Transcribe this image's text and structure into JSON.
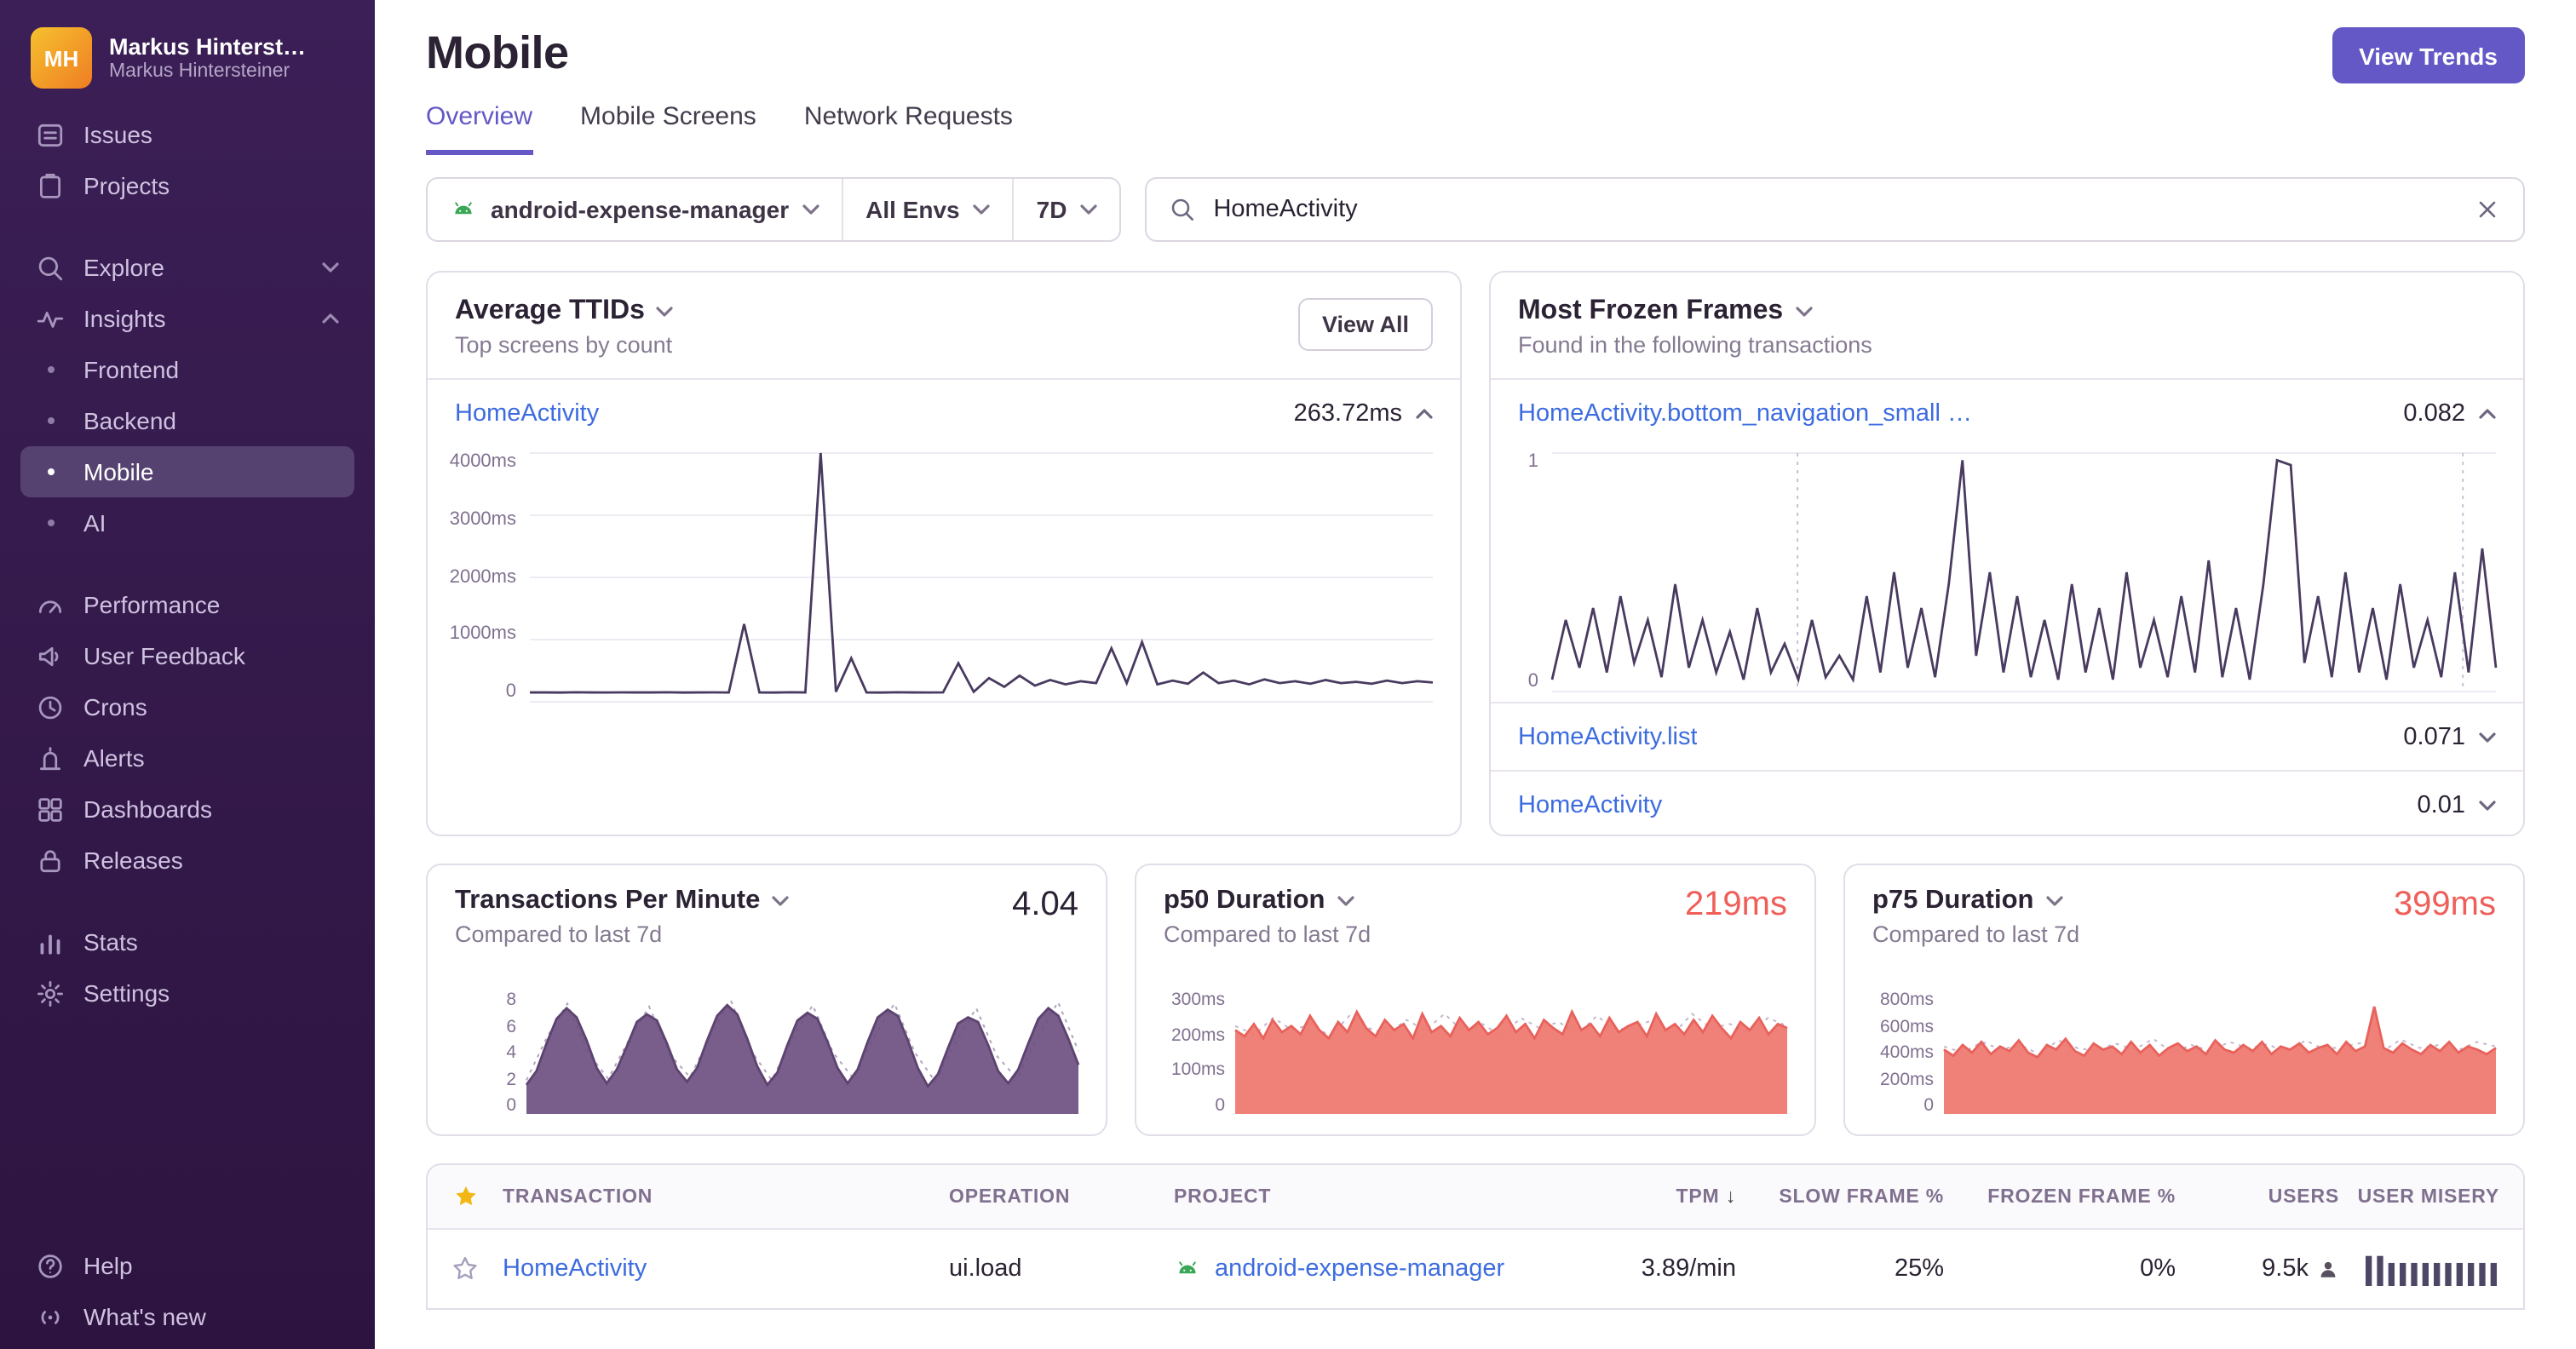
{
  "colors": {
    "accent": "#6358c6",
    "link": "#3d6ce0",
    "danger": "#ef5e58",
    "android_green": "#3aa757",
    "star_gold": "#f2b712"
  },
  "sidebar": {
    "account": {
      "initials": "MH",
      "name": "Markus Hinterst…",
      "subtitle": "Markus Hintersteiner"
    },
    "primary": [
      "Issues",
      "Projects"
    ],
    "explore_label": "Explore",
    "insights_label": "Insights",
    "insights_children": [
      "Frontend",
      "Backend",
      "Mobile",
      "AI"
    ],
    "secondary": [
      "Performance",
      "User Feedback",
      "Crons",
      "Alerts",
      "Dashboards",
      "Releases"
    ],
    "tertiary": [
      "Stats",
      "Settings"
    ],
    "footer": [
      "Help",
      "What's new"
    ]
  },
  "header": {
    "title": "Mobile",
    "view_trends_label": "View Trends"
  },
  "tabs": [
    "Overview",
    "Mobile Screens",
    "Network Requests"
  ],
  "filters": {
    "project": "android-expense-manager",
    "env": "All Envs",
    "period": "7D",
    "search_value": "HomeActivity"
  },
  "cards": {
    "ttid": {
      "title": "Average TTIDs",
      "subtitle": "Top screens by count",
      "view_all_label": "View All",
      "row_label": "HomeActivity",
      "row_value": "263.72ms",
      "y_labels": [
        "4000ms",
        "3000ms",
        "2000ms",
        "1000ms",
        "0"
      ]
    },
    "frozen": {
      "title": "Most Frozen Frames",
      "subtitle": "Found in the following transactions",
      "rows": [
        {
          "label": "HomeActivity.bottom_navigation_small …",
          "value": "0.082"
        },
        {
          "label": "HomeActivity.list",
          "value": "0.071"
        },
        {
          "label": "HomeActivity",
          "value": "0.01"
        }
      ],
      "y_labels": [
        "1",
        "0"
      ]
    },
    "tpm": {
      "title": "Transactions Per Minute",
      "value": "4.04",
      "subtitle": "Compared to last 7d",
      "y_labels": [
        "8",
        "6",
        "4",
        "2",
        "0"
      ]
    },
    "p50": {
      "title": "p50 Duration",
      "value": "219ms",
      "subtitle": "Compared to last 7d",
      "y_labels": [
        "300ms",
        "200ms",
        "100ms",
        "0"
      ]
    },
    "p75": {
      "title": "p75 Duration",
      "value": "399ms",
      "subtitle": "Compared to last 7d",
      "y_labels": [
        "800ms",
        "600ms",
        "400ms",
        "200ms",
        "0"
      ]
    }
  },
  "charts": {
    "ttid": {
      "type": "line",
      "color": "#493a60",
      "max": 4000,
      "grid": [
        0,
        25,
        50,
        75,
        100
      ],
      "values": [
        150,
        150,
        148,
        152,
        150,
        149,
        151,
        150,
        150,
        152,
        148,
        150,
        151,
        149,
        1250,
        150,
        148,
        152,
        150,
        4000,
        160,
        700,
        150,
        148,
        152,
        150,
        149,
        151,
        620,
        160,
        380,
        240,
        420,
        260,
        350,
        280,
        330,
        300,
        860,
        300,
        960,
        280,
        340,
        290,
        470,
        300,
        340,
        280,
        360,
        300,
        330,
        290,
        350,
        300,
        320,
        290,
        340,
        300,
        330,
        310
      ]
    },
    "frozen": {
      "type": "line",
      "color": "#493a60",
      "max": 1,
      "grid": [
        0,
        100
      ],
      "markers_pct": [
        26,
        96.5
      ],
      "values": [
        0.05,
        0.3,
        0.1,
        0.35,
        0.08,
        0.4,
        0.12,
        0.3,
        0.06,
        0.45,
        0.1,
        0.3,
        0.08,
        0.25,
        0.05,
        0.35,
        0.08,
        0.2,
        0.05,
        0.3,
        0.06,
        0.15,
        0.05,
        0.4,
        0.08,
        0.5,
        0.1,
        0.35,
        0.06,
        0.45,
        0.97,
        0.15,
        0.5,
        0.08,
        0.4,
        0.06,
        0.3,
        0.05,
        0.45,
        0.08,
        0.35,
        0.05,
        0.5,
        0.1,
        0.3,
        0.06,
        0.4,
        0.08,
        0.55,
        0.06,
        0.35,
        0.05,
        0.45,
        0.97,
        0.95,
        0.12,
        0.4,
        0.06,
        0.5,
        0.08,
        0.35,
        0.05,
        0.45,
        0.1,
        0.3,
        0.06,
        0.5,
        0.08,
        0.6,
        0.1
      ]
    },
    "tpm": {
      "type": "area",
      "color": "#5d4370",
      "fill": "#6e4f80",
      "fill_opacity": 0.92,
      "max": 8,
      "values": [
        1.9,
        2.8,
        4.6,
        6.2,
        6.9,
        6.3,
        4.8,
        3.0,
        2.0,
        2.9,
        4.4,
        6.0,
        6.5,
        6.1,
        4.6,
        2.9,
        2.1,
        3.0,
        4.8,
        6.4,
        7.1,
        6.5,
        4.9,
        3.1,
        1.9,
        2.7,
        4.5,
        6.1,
        6.6,
        6.2,
        4.7,
        3.0,
        2.0,
        2.9,
        4.7,
        6.3,
        6.8,
        6.4,
        4.8,
        3.0,
        1.8,
        2.6,
        4.3,
        5.9,
        6.3,
        6.0,
        4.5,
        2.8,
        2.0,
        2.9,
        4.6,
        6.2,
        6.9,
        6.4,
        4.9,
        3.2
      ],
      "prev": {
        "color": "#b0a6bd",
        "values": [
          2.2,
          5.0,
          7.2,
          4.0,
          2.3,
          4.8,
          7.0,
          3.9,
          2.4,
          5.1,
          7.4,
          4.1,
          2.2,
          4.9,
          7.1,
          4.0,
          2.3,
          5.0,
          7.2,
          4.0,
          2.1,
          4.7,
          6.9,
          3.8,
          2.3,
          5.0,
          7.3,
          4.1
        ]
      }
    },
    "p50": {
      "type": "area",
      "color": "#e8625c",
      "fill": "#ef7a72",
      "fill_opacity": 0.95,
      "max": 300,
      "values": [
        205,
        190,
        220,
        185,
        230,
        200,
        215,
        195,
        240,
        205,
        185,
        225,
        200,
        250,
        210,
        190,
        230,
        205,
        220,
        185,
        245,
        200,
        215,
        190,
        235,
        205,
        225,
        195,
        210,
        240,
        200,
        220,
        185,
        230,
        210,
        195,
        250,
        205,
        220,
        190,
        235,
        200,
        215,
        225,
        190,
        245,
        205,
        220,
        195,
        230,
        200,
        240,
        210,
        185,
        225,
        205,
        235,
        195,
        220,
        210
      ],
      "prev": {
        "color": "#c2b8cc",
        "values": [
          215,
          195,
          235,
          205,
          220,
          190,
          240,
          210,
          195,
          230,
          205,
          245,
          200,
          220,
          190,
          235,
          210,
          225,
          195,
          240,
          205,
          215,
          230,
          195,
          245,
          210,
          220,
          200,
          235,
          215
        ]
      }
    },
    "p75": {
      "type": "area",
      "color": "#e8625c",
      "fill": "#ef7a72",
      "fill_opacity": 0.95,
      "max": 800,
      "values": [
        420,
        380,
        450,
        400,
        470,
        390,
        440,
        410,
        480,
        400,
        370,
        450,
        420,
        490,
        410,
        380,
        460,
        420,
        440,
        390,
        470,
        400,
        450,
        380,
        430,
        460,
        410,
        440,
        390,
        480,
        420,
        400,
        450,
        410,
        470,
        390,
        440,
        420,
        460,
        400,
        430,
        450,
        390,
        470,
        410,
        440,
        700,
        430,
        400,
        460,
        420,
        390,
        450,
        410,
        470,
        400,
        440,
        420,
        390,
        430
      ],
      "prev": {
        "color": "#c2b8cc",
        "values": [
          440,
          400,
          470,
          420,
          450,
          390,
          480,
          430,
          410,
          460,
          420,
          490,
          400,
          450,
          410,
          470,
          430,
          455,
          400,
          480,
          420,
          440,
          465,
          405,
          485,
          430,
          450,
          415,
          470,
          440
        ]
      }
    }
  },
  "table": {
    "headers": [
      "TRANSACTION",
      "OPERATION",
      "PROJECT",
      "TPM",
      "SLOW FRAME %",
      "FROZEN FRAME %",
      "USERS",
      "USER MISERY"
    ],
    "sort_indicator": "↓",
    "rows": [
      {
        "transaction": "HomeActivity",
        "operation": "ui.load",
        "project": "android-expense-manager",
        "tpm": "3.89/min",
        "slow_frame": "25%",
        "frozen_frame": "0%",
        "users": "9.5k",
        "misery_chart": {
          "type": "bars",
          "color": "#4d4765",
          "max": 3.4,
          "values": [
            3,
            3,
            2.3,
            2.3,
            2.3,
            2.3,
            2.3,
            2.3,
            2.3,
            2.3,
            2.3,
            2.3
          ]
        }
      }
    ]
  }
}
